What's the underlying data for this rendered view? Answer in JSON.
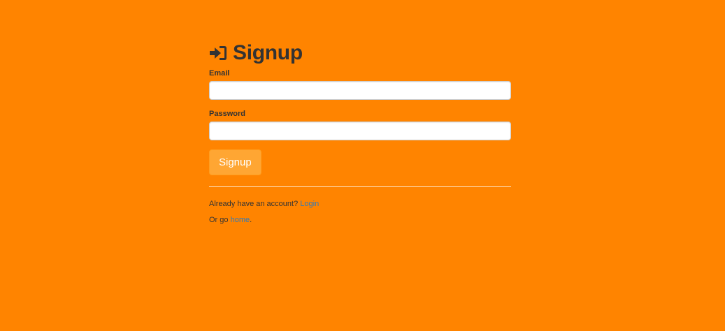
{
  "heading": {
    "icon": "sign-in-icon",
    "text": "Signup"
  },
  "form": {
    "email": {
      "label": "Email",
      "value": "",
      "placeholder": ""
    },
    "password": {
      "label": "Password",
      "value": "",
      "placeholder": ""
    },
    "submit_label": "Signup"
  },
  "footer": {
    "login_prefix": "Already have an account? ",
    "login_link": "Login",
    "home_prefix": "Or go ",
    "home_link": "home",
    "home_suffix": "."
  },
  "colors": {
    "background": "#ff8400",
    "button": "#ffa633",
    "link": "#337ab7",
    "text": "#333333"
  }
}
